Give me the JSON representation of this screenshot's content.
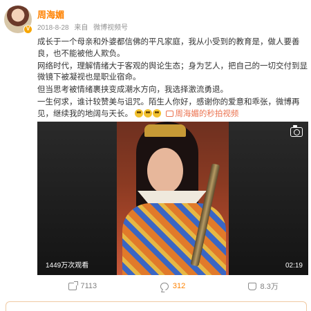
{
  "user": {
    "name": "周海媚"
  },
  "meta": {
    "date": "2018-8-28",
    "source_prefix": "来自",
    "source": "微博视频号"
  },
  "content": {
    "p1": "成长于一个母亲和外婆都信佛的平凡家庭，我从小受到的教育是，做人要善良，也不能被他人欺负。",
    "p2": "网络时代，理解情绪大于客观的舆论生态；身为艺人，把自己的一切交付到显微镜下被凝视也是职业宿命。",
    "p3": "但当思考被情绪裹挟变成潮水方向，我选择激流勇退。",
    "p4": "一生何求，谁计较赞美与诅咒。陌生人你好，感谢你的爱意和乖张，微博再见，继续我的地阔与天长。",
    "video_link": "周海媚的秒拍视频"
  },
  "video": {
    "views": "1449万次观看",
    "duration": "02:19"
  },
  "actions": {
    "repost": "7113",
    "comment": "312",
    "like": "8.3万"
  }
}
